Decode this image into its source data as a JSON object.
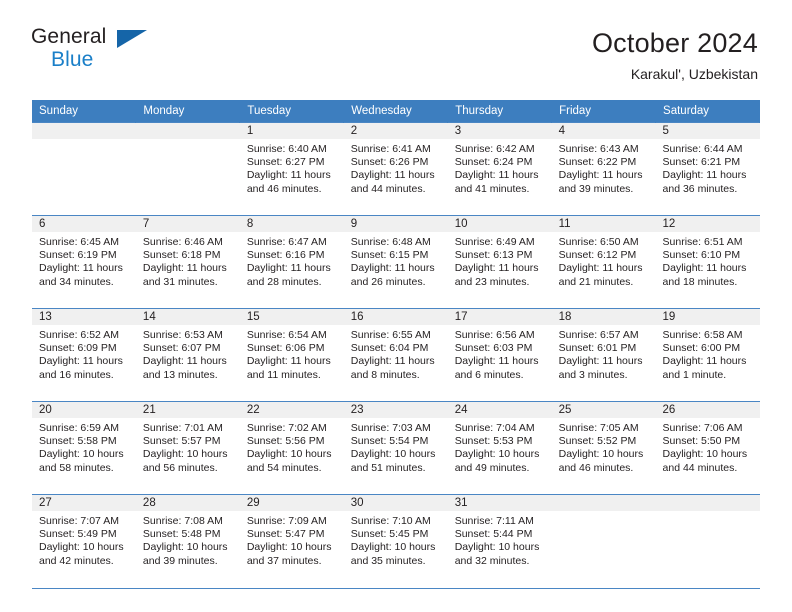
{
  "brand": {
    "line1": "General",
    "line2": "Blue",
    "flag_icon": "triangle-flag-icon",
    "color_dark": "#231f20",
    "color_blue": "#1a7fc8"
  },
  "header": {
    "title": "October 2024",
    "subtitle": "Karakul', Uzbekistan"
  },
  "theme": {
    "header_bg": "#3d7ebf",
    "header_text": "#ffffff",
    "daynum_bg": "#f0f0f0",
    "grid_line": "#4a86c4",
    "body_text": "#231f20"
  },
  "calendar": {
    "weekday_headers": [
      "Sunday",
      "Monday",
      "Tuesday",
      "Wednesday",
      "Thursday",
      "Friday",
      "Saturday"
    ],
    "weeks": [
      [
        {
          "day": "",
          "lines": []
        },
        {
          "day": "",
          "lines": []
        },
        {
          "day": "1",
          "lines": [
            "Sunrise: 6:40 AM",
            "Sunset: 6:27 PM",
            "Daylight: 11 hours",
            "and 46 minutes."
          ]
        },
        {
          "day": "2",
          "lines": [
            "Sunrise: 6:41 AM",
            "Sunset: 6:26 PM",
            "Daylight: 11 hours",
            "and 44 minutes."
          ]
        },
        {
          "day": "3",
          "lines": [
            "Sunrise: 6:42 AM",
            "Sunset: 6:24 PM",
            "Daylight: 11 hours",
            "and 41 minutes."
          ]
        },
        {
          "day": "4",
          "lines": [
            "Sunrise: 6:43 AM",
            "Sunset: 6:22 PM",
            "Daylight: 11 hours",
            "and 39 minutes."
          ]
        },
        {
          "day": "5",
          "lines": [
            "Sunrise: 6:44 AM",
            "Sunset: 6:21 PM",
            "Daylight: 11 hours",
            "and 36 minutes."
          ]
        }
      ],
      [
        {
          "day": "6",
          "lines": [
            "Sunrise: 6:45 AM",
            "Sunset: 6:19 PM",
            "Daylight: 11 hours",
            "and 34 minutes."
          ]
        },
        {
          "day": "7",
          "lines": [
            "Sunrise: 6:46 AM",
            "Sunset: 6:18 PM",
            "Daylight: 11 hours",
            "and 31 minutes."
          ]
        },
        {
          "day": "8",
          "lines": [
            "Sunrise: 6:47 AM",
            "Sunset: 6:16 PM",
            "Daylight: 11 hours",
            "and 28 minutes."
          ]
        },
        {
          "day": "9",
          "lines": [
            "Sunrise: 6:48 AM",
            "Sunset: 6:15 PM",
            "Daylight: 11 hours",
            "and 26 minutes."
          ]
        },
        {
          "day": "10",
          "lines": [
            "Sunrise: 6:49 AM",
            "Sunset: 6:13 PM",
            "Daylight: 11 hours",
            "and 23 minutes."
          ]
        },
        {
          "day": "11",
          "lines": [
            "Sunrise: 6:50 AM",
            "Sunset: 6:12 PM",
            "Daylight: 11 hours",
            "and 21 minutes."
          ]
        },
        {
          "day": "12",
          "lines": [
            "Sunrise: 6:51 AM",
            "Sunset: 6:10 PM",
            "Daylight: 11 hours",
            "and 18 minutes."
          ]
        }
      ],
      [
        {
          "day": "13",
          "lines": [
            "Sunrise: 6:52 AM",
            "Sunset: 6:09 PM",
            "Daylight: 11 hours",
            "and 16 minutes."
          ]
        },
        {
          "day": "14",
          "lines": [
            "Sunrise: 6:53 AM",
            "Sunset: 6:07 PM",
            "Daylight: 11 hours",
            "and 13 minutes."
          ]
        },
        {
          "day": "15",
          "lines": [
            "Sunrise: 6:54 AM",
            "Sunset: 6:06 PM",
            "Daylight: 11 hours",
            "and 11 minutes."
          ]
        },
        {
          "day": "16",
          "lines": [
            "Sunrise: 6:55 AM",
            "Sunset: 6:04 PM",
            "Daylight: 11 hours",
            "and 8 minutes."
          ]
        },
        {
          "day": "17",
          "lines": [
            "Sunrise: 6:56 AM",
            "Sunset: 6:03 PM",
            "Daylight: 11 hours",
            "and 6 minutes."
          ]
        },
        {
          "day": "18",
          "lines": [
            "Sunrise: 6:57 AM",
            "Sunset: 6:01 PM",
            "Daylight: 11 hours",
            "and 3 minutes."
          ]
        },
        {
          "day": "19",
          "lines": [
            "Sunrise: 6:58 AM",
            "Sunset: 6:00 PM",
            "Daylight: 11 hours",
            "and 1 minute."
          ]
        }
      ],
      [
        {
          "day": "20",
          "lines": [
            "Sunrise: 6:59 AM",
            "Sunset: 5:58 PM",
            "Daylight: 10 hours",
            "and 58 minutes."
          ]
        },
        {
          "day": "21",
          "lines": [
            "Sunrise: 7:01 AM",
            "Sunset: 5:57 PM",
            "Daylight: 10 hours",
            "and 56 minutes."
          ]
        },
        {
          "day": "22",
          "lines": [
            "Sunrise: 7:02 AM",
            "Sunset: 5:56 PM",
            "Daylight: 10 hours",
            "and 54 minutes."
          ]
        },
        {
          "day": "23",
          "lines": [
            "Sunrise: 7:03 AM",
            "Sunset: 5:54 PM",
            "Daylight: 10 hours",
            "and 51 minutes."
          ]
        },
        {
          "day": "24",
          "lines": [
            "Sunrise: 7:04 AM",
            "Sunset: 5:53 PM",
            "Daylight: 10 hours",
            "and 49 minutes."
          ]
        },
        {
          "day": "25",
          "lines": [
            "Sunrise: 7:05 AM",
            "Sunset: 5:52 PM",
            "Daylight: 10 hours",
            "and 46 minutes."
          ]
        },
        {
          "day": "26",
          "lines": [
            "Sunrise: 7:06 AM",
            "Sunset: 5:50 PM",
            "Daylight: 10 hours",
            "and 44 minutes."
          ]
        }
      ],
      [
        {
          "day": "27",
          "lines": [
            "Sunrise: 7:07 AM",
            "Sunset: 5:49 PM",
            "Daylight: 10 hours",
            "and 42 minutes."
          ]
        },
        {
          "day": "28",
          "lines": [
            "Sunrise: 7:08 AM",
            "Sunset: 5:48 PM",
            "Daylight: 10 hours",
            "and 39 minutes."
          ]
        },
        {
          "day": "29",
          "lines": [
            "Sunrise: 7:09 AM",
            "Sunset: 5:47 PM",
            "Daylight: 10 hours",
            "and 37 minutes."
          ]
        },
        {
          "day": "30",
          "lines": [
            "Sunrise: 7:10 AM",
            "Sunset: 5:45 PM",
            "Daylight: 10 hours",
            "and 35 minutes."
          ]
        },
        {
          "day": "31",
          "lines": [
            "Sunrise: 7:11 AM",
            "Sunset: 5:44 PM",
            "Daylight: 10 hours",
            "and 32 minutes."
          ]
        },
        {
          "day": "",
          "lines": []
        },
        {
          "day": "",
          "lines": []
        }
      ]
    ]
  }
}
